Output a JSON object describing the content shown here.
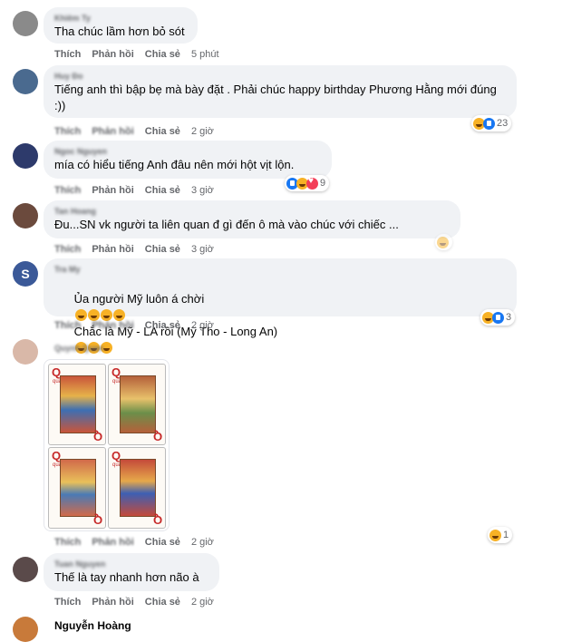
{
  "labels": {
    "like": "Thích",
    "reply": "Phản hồi",
    "share": "Chia sẻ"
  },
  "comments": [
    {
      "author": "Khiêm Ty",
      "text": "Tha chúc lầm hơn bỏ sót",
      "time": "5 phút",
      "avatar_color": "#8a8a8a"
    },
    {
      "author": "Huy Đo",
      "text": "Tiếng anh thì bập bẹ mà bày đặt . Phải chúc happy birthday Phương Hằng mới đúng\n:))",
      "time": "2 giờ",
      "reaction_count": "23",
      "avatar_color": "#4a6a8f"
    },
    {
      "author": "Ngoc Nguyen",
      "text": "mía có hiểu tiếng Anh đâu nên mới hột vịt lộn.",
      "time": "3 giờ",
      "reaction_count": "9",
      "avatar_color": "#2d3a6b"
    },
    {
      "author": "Tan Hoang",
      "text": "Đu...SN vk người ta liên quan đ gì đến ô mà vào chúc với chiếc ...",
      "time": "3 giờ",
      "avatar_color": "#6b4a3d"
    },
    {
      "author": "Tra My",
      "text": "Ủa người Mỹ luôn á chời",
      "text2": "Chắc là Mỹ - LA rồi (Mỹ Tho - Long An)",
      "time": "2 giờ",
      "reaction_count": "3",
      "avatar_letter": "S",
      "avatar_color": "#3b5998"
    },
    {
      "author": "Quynh Quan",
      "time": "2 giờ",
      "reaction_count": "1",
      "card_rank": "Q",
      "card_suit": "quả",
      "avatar_color": "#d9b8a8"
    },
    {
      "author": "Tuan Nguyen",
      "text": "Thế là tay nhanh hơn não à",
      "time": "2 giờ",
      "avatar_color": "#5a4a4a"
    },
    {
      "author": "Nguyễn Hoàng",
      "avatar_color": "#c87a3a"
    }
  ]
}
